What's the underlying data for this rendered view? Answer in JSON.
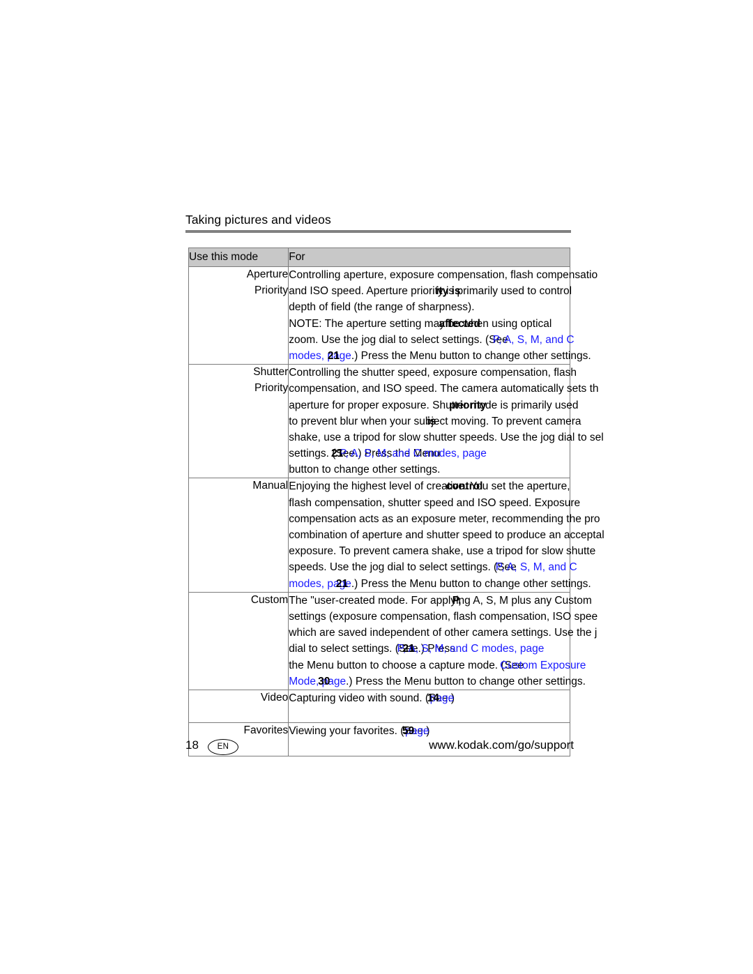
{
  "document": {
    "running_head": "Taking pictures and videos",
    "page_number": "18",
    "language_badge": "EN",
    "support_url": "www.kodak.com/go/support",
    "link_color": "#1a1aff",
    "header_fill": "#c8c8c8",
    "rule_color": "#808080"
  },
  "table": {
    "headers": {
      "mode": "Use this mode",
      "for": "For"
    },
    "rows": [
      {
        "mode": "Aperture\nPriority",
        "mode_line1": "Aperture",
        "mode_line2": "Priority",
        "lines": [
          {
            "segments": [
              {
                "text": "Controlling aperture, exposure compensation, flash compensatio",
                "style": "normal"
              }
            ]
          },
          {
            "segments": [
              {
                "text": "and ISO speed. Aperture priority is",
                "style": "normal"
              },
              {
                "text": "ity is",
                "style": "overlap-bold"
              },
              {
                "text": " primarily used to control",
                "style": "normal"
              }
            ]
          },
          {
            "segments": [
              {
                "text": "depth of field (the range of sharpness).",
                "style": "normal"
              }
            ]
          },
          {
            "segments": [
              {
                "text": "NOTE: The aperture setting may be",
                "style": "normal"
              },
              {
                "text": "affected",
                "style": "overlap-bold"
              },
              {
                "text": " when using optical",
                "style": "normal"
              }
            ]
          },
          {
            "segments": [
              {
                "text": "zoom. Use the jog dial to select settings. (See",
                "style": "normal"
              },
              {
                "text": "P, A, S, M, and C",
                "style": "overlap-link"
              }
            ]
          },
          {
            "segments": [
              {
                "text": "modes, page",
                "style": "link"
              },
              {
                "text": "21",
                "style": "overlap-bold"
              },
              {
                "text": ".) Press the Menu button to change other settings.",
                "style": "normal"
              }
            ]
          }
        ]
      },
      {
        "mode": "Shutter\nPriority",
        "mode_line1": "Shutter",
        "mode_line2": "Priority",
        "lines": [
          {
            "segments": [
              {
                "text": "Controlling the shutter speed, exposure compensation, flash",
                "style": "normal"
              }
            ]
          },
          {
            "segments": [
              {
                "text": "compensation, and ISO speed. The camera automatically sets th",
                "style": "normal"
              }
            ]
          },
          {
            "segments": [
              {
                "text": "aperture for proper exposure. Shutter",
                "style": "normal"
              },
              {
                "text": "priority",
                "style": "overlap-bold"
              },
              {
                "text": " mode is primarily used",
                "style": "normal"
              }
            ]
          },
          {
            "segments": [
              {
                "text": "to prevent blur when your subject",
                "style": "normal"
              },
              {
                "text": "is",
                "style": "overlap-bold"
              },
              {
                "text": " moving. To prevent camera",
                "style": "normal"
              }
            ]
          },
          {
            "segments": [
              {
                "text": "shake, use a tripod for slow shutter speeds. Use the jog dial to sel",
                "style": "normal"
              }
            ]
          },
          {
            "segments": [
              {
                "text": "settings. (See",
                "style": "normal"
              },
              {
                "text": "P, A, S, M, and C modes, page",
                "style": "overlap-link"
              },
              {
                "text": "21",
                "style": "overlap-bold"
              },
              {
                "text": ".) Press the Menu",
                "style": "normal"
              }
            ]
          },
          {
            "segments": [
              {
                "text": "button to change other settings.",
                "style": "normal"
              }
            ]
          }
        ]
      },
      {
        "mode": "Manual",
        "mode_line1": "Manual",
        "mode_line2": "",
        "lines": [
          {
            "segments": [
              {
                "text": "Enjoying the highest level of creative",
                "style": "normal"
              },
              {
                "text": "control",
                "style": "overlap-bold"
              },
              {
                "text": ". You set the aperture,",
                "style": "normal"
              }
            ]
          },
          {
            "segments": [
              {
                "text": "flash compensation, shutter speed and ISO speed. Exposure",
                "style": "normal"
              }
            ]
          },
          {
            "segments": [
              {
                "text": "compensation acts as an exposure meter, recommending the pro",
                "style": "normal"
              }
            ]
          },
          {
            "segments": [
              {
                "text": "combination of aperture and shutter speed to produce an acceptal",
                "style": "normal"
              }
            ]
          },
          {
            "segments": [
              {
                "text": "exposure. To prevent camera shake, use a tripod for slow shutte",
                "style": "normal"
              }
            ]
          },
          {
            "segments": [
              {
                "text": "speeds. Use the jog dial to select settings. (See",
                "style": "normal"
              },
              {
                "text": "P, A, S, M, and C",
                "style": "overlap-link"
              }
            ]
          },
          {
            "segments": [
              {
                "text": "modes, page",
                "style": "link"
              },
              {
                "text": "21",
                "style": "overlap-bold"
              },
              {
                "text": ".) Press the Menu button to change other settings.",
                "style": "normal"
              }
            ]
          }
        ]
      },
      {
        "mode": "Custom",
        "mode_line1": "Custom",
        "mode_line2": "",
        "lines": [
          {
            "segments": [
              {
                "text": "The \"user-created  mode. For applying",
                "style": "normal"
              },
              {
                "text": "P,",
                "style": "overlap-bold"
              },
              {
                "text": " A, S, M plus any Custom",
                "style": "normal"
              }
            ]
          },
          {
            "segments": [
              {
                "text": "settings (exposure compensation, flash compensation, ISO spee",
                "style": "normal"
              }
            ]
          },
          {
            "segments": [
              {
                "text": "which are saved independent of other camera settings. Use the j",
                "style": "normal"
              }
            ]
          },
          {
            "segments": [
              {
                "text": "dial to select settings. (See",
                "style": "normal"
              },
              {
                "text": "P, A, S, M, and C modes, page",
                "style": "overlap-link"
              },
              {
                "text": "21",
                "style": "overlap-bold"
              },
              {
                "text": ".) Press",
                "style": "normal"
              }
            ]
          },
          {
            "segments": [
              {
                "text": "the Menu button to choose a capture mode. (See",
                "style": "normal"
              },
              {
                "text": "Custom Exposure",
                "style": "overlap-link"
              }
            ]
          },
          {
            "segments": [
              {
                "text": "Mode, page",
                "style": "link"
              },
              {
                "text": "30",
                "style": "overlap-bold"
              },
              {
                "text": ".) Press the Menu button to change other settings.",
                "style": "normal"
              }
            ]
          }
        ]
      },
      {
        "mode": "Video",
        "mode_line1": "Video",
        "mode_line2": "",
        "lines": [
          {
            "segments": [
              {
                "text": "Capturing video with sound. (See",
                "style": "normal"
              },
              {
                "text": "page",
                "style": "overlap-link"
              },
              {
                "text": "14",
                "style": "overlap-bold"
              },
              {
                "text": ".)",
                "style": "normal"
              }
            ]
          }
        ]
      },
      {
        "mode": "Favorites",
        "mode_line1": "Favorites",
        "mode_line2": "",
        "lines": [
          {
            "segments": [
              {
                "text": "Viewing your favorites. (See",
                "style": "normal"
              },
              {
                "text": "page",
                "style": "overlap-link"
              },
              {
                "text": "59",
                "style": "overlap-bold"
              },
              {
                "text": ".)",
                "style": "normal"
              }
            ]
          }
        ]
      }
    ]
  }
}
